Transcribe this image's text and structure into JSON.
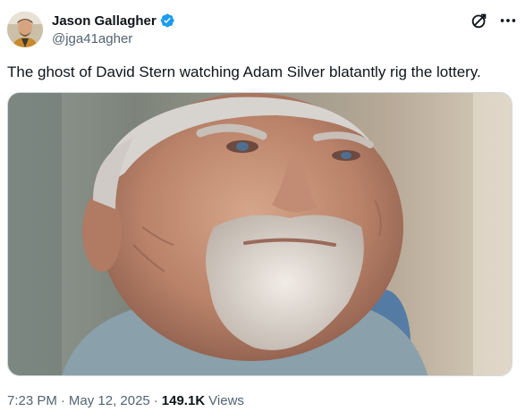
{
  "author": {
    "display_name": "Jason Gallagher",
    "handle": "@jga41agher",
    "verified": true,
    "avatar_icon": "avatar-photo"
  },
  "actions": {
    "grok_icon": "grok-icon",
    "more_icon": "more-options-icon"
  },
  "tweet": {
    "text": "The ghost of David Stern watching Adam Silver blatantly rig the lottery."
  },
  "media": {
    "description_icon": "photo-elderly-man-white-beard"
  },
  "meta": {
    "time": "7:23 PM",
    "date": "May 12, 2025",
    "separator": "·",
    "views_count": "149.1K",
    "views_label": "Views"
  },
  "colors": {
    "verified_blue": "#1d9bf0",
    "text_primary": "#0f1419",
    "text_secondary": "#536471"
  }
}
